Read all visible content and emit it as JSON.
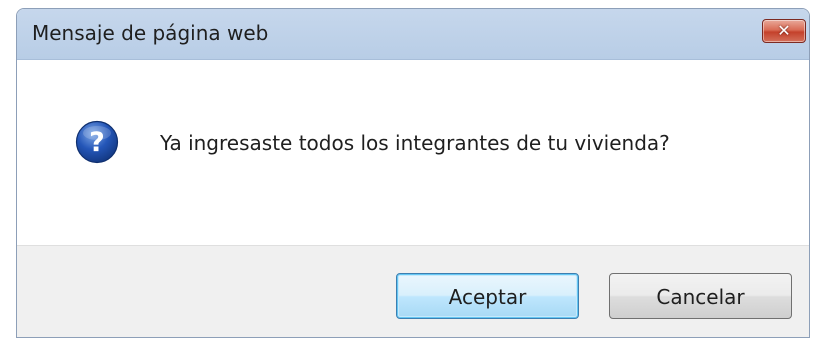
{
  "window": {
    "title": "Mensaje de página web",
    "close_symbol": "✕"
  },
  "message": {
    "icon": "question-icon",
    "text": "Ya ingresaste todos los integrantes de tu vivienda?"
  },
  "buttons": {
    "ok_label": "Aceptar",
    "cancel_label": "Cancelar"
  },
  "colors": {
    "titlebar": "#b8cde6",
    "close_button": "#c4412b",
    "icon_blue": "#1f4fa3",
    "footer": "#f0f0f0"
  }
}
